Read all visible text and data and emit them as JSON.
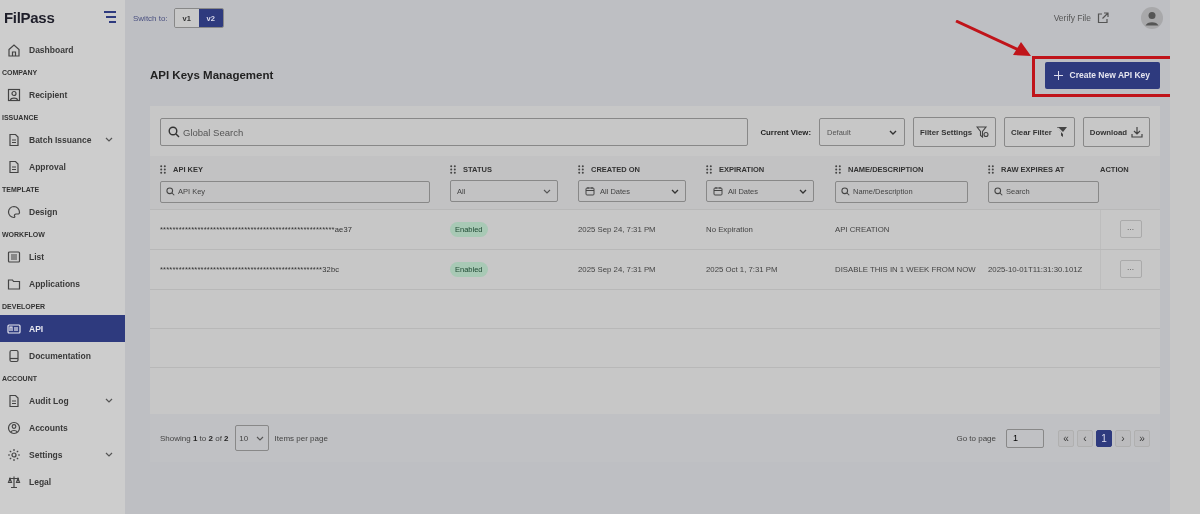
{
  "sidebar": {
    "logo": "FilPass",
    "sections": [
      {
        "items": [
          {
            "label": "Dashboard",
            "selected": false,
            "expandable": false
          }
        ]
      },
      {
        "label": "COMPANY",
        "items": [
          {
            "label": "Recipient",
            "selected": false,
            "expandable": false
          }
        ]
      },
      {
        "label": "ISSUANCE",
        "items": [
          {
            "label": "Batch Issuance",
            "selected": false,
            "expandable": true
          },
          {
            "label": "Approval",
            "selected": false,
            "expandable": false
          }
        ]
      },
      {
        "label": "TEMPLATE",
        "items": [
          {
            "label": "Design",
            "selected": false,
            "expandable": false
          }
        ]
      },
      {
        "label": "WORKFLOW",
        "items": [
          {
            "label": "List",
            "selected": false,
            "expandable": false
          },
          {
            "label": "Applications",
            "selected": false,
            "expandable": false
          }
        ]
      },
      {
        "label": "DEVELOPER",
        "items": [
          {
            "label": "API",
            "selected": true,
            "expandable": false
          },
          {
            "label": "Documentation",
            "selected": false,
            "expandable": false
          }
        ]
      },
      {
        "label": "ACCOUNT",
        "items": [
          {
            "label": "Audit Log",
            "selected": false,
            "expandable": true
          },
          {
            "label": "Accounts",
            "selected": false,
            "expandable": false
          },
          {
            "label": "Settings",
            "selected": false,
            "expandable": true
          },
          {
            "label": "Legal",
            "selected": false,
            "expandable": false
          }
        ]
      }
    ]
  },
  "topbar": {
    "switch_label": "Switch to:",
    "versions": [
      {
        "label": "v1",
        "selected": false
      },
      {
        "label": "v2",
        "selected": true
      }
    ],
    "verify_file": "Verify File"
  },
  "page": {
    "title": "API Keys Management",
    "create_button": "Create New API Key"
  },
  "toolbar": {
    "search_placeholder": "Global Search",
    "current_view_label": "Current View:",
    "current_view_value": "Default",
    "buttons": [
      "Filter Settings",
      "Clear Filter",
      "Download"
    ]
  },
  "table": {
    "columns": [
      {
        "label": "API KEY",
        "drag_handle": true,
        "filter": {
          "kind": "search",
          "placeholder": "API Key"
        }
      },
      {
        "label": "STATUS",
        "drag_handle": true,
        "filter": {
          "kind": "select",
          "value": "All"
        }
      },
      {
        "label": "CREATED ON",
        "drag_handle": true,
        "filter": {
          "kind": "date",
          "value": "All Dates"
        }
      },
      {
        "label": "EXPIRATION",
        "drag_handle": true,
        "filter": {
          "kind": "date",
          "value": "All Dates"
        }
      },
      {
        "label": "NAME/DESCRIPTION",
        "drag_handle": true,
        "filter": {
          "kind": "search",
          "placeholder": "Name/Description"
        }
      },
      {
        "label": "RAW EXPIRES AT",
        "drag_handle": true,
        "filter": {
          "kind": "search",
          "placeholder": "Search"
        }
      },
      {
        "label": "ACTION",
        "drag_handle": false
      }
    ],
    "rows": [
      {
        "api_key": "********************************************************ae37",
        "status": {
          "label": "Enabled",
          "kind": "enabled"
        },
        "created_on": "2025 Sep 24, 7:31 PM",
        "expiration": "No Expiration",
        "name": "API CREATION",
        "action": "···"
      },
      {
        "api_key": "****************************************************32bc",
        "status": {
          "label": "Enabled",
          "kind": "enabled"
        },
        "created_on": "2025 Sep 24, 7:31 PM",
        "expiration": "2025 Oct 1, 7:31 PM",
        "name": "DISABLE THIS IN 1 WEEK FROM NOW",
        "raw_expires_at": "2025-10-01T11:31:30.101Z",
        "action": "···"
      }
    ]
  },
  "footer": {
    "showing": "Showing **1** to **2** of **2**",
    "per_page": "10",
    "per_page_label": "Items per page",
    "go_to_label": "Go to page",
    "go_to_value": "1",
    "pages": [
      {
        "label": "«",
        "kind": "nav",
        "disabled": true
      },
      {
        "label": "‹",
        "kind": "nav",
        "disabled": true
      },
      {
        "label": "1",
        "kind": "page",
        "selected": true
      },
      {
        "label": "›",
        "kind": "nav",
        "disabled": true
      },
      {
        "label": "»",
        "kind": "nav",
        "disabled": true
      }
    ]
  }
}
